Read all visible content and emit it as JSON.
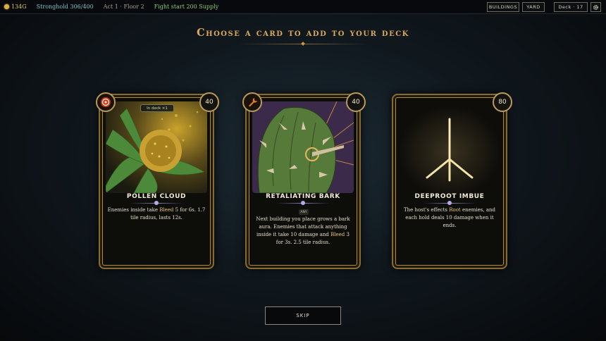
{
  "topbar": {
    "gold": "134G",
    "stronghold": "Stronghold 306/400",
    "act": "Act 1 · Floor 2",
    "supply": "Fight start 200 Supply",
    "buildings_label": "BUILDINGS",
    "yard_label": "YARD",
    "deck_label": "Deck · 17",
    "icons": {
      "gold": "coin-icon",
      "settings": "gear-icon"
    }
  },
  "title": "Choose a card to add to your deck",
  "cards": [
    {
      "cost": "40",
      "name": "POLLEN CLOUD",
      "badge": "In deck ×1",
      "type_icon": "target-icon",
      "desc_parts": [
        "Enemies inside take ",
        "Bleed",
        " 5 for 6s. 1.7 tile radius, lasts 12s."
      ]
    },
    {
      "cost": "40",
      "name": "RETALIATING BARK",
      "tag": "ANY",
      "type_icon": "wrench-icon",
      "desc_parts": [
        "Next building you place grows a bark aura. Enemies that attack anything inside it take 10 damage and ",
        "Bleed",
        " 3 for 3s. 2.5 tile radius."
      ]
    },
    {
      "cost": "80",
      "name": "DEEPROOT IMBUE",
      "desc_parts": [
        "The host's effects ",
        "Root",
        " enemies, and each hold deals 10 damage when it ends."
      ]
    }
  ],
  "skip_label": "SKIP",
  "colors": {
    "accent_gold": "#d9a85a",
    "highlight": "#e9c770",
    "card_border": "#b38b3a"
  }
}
